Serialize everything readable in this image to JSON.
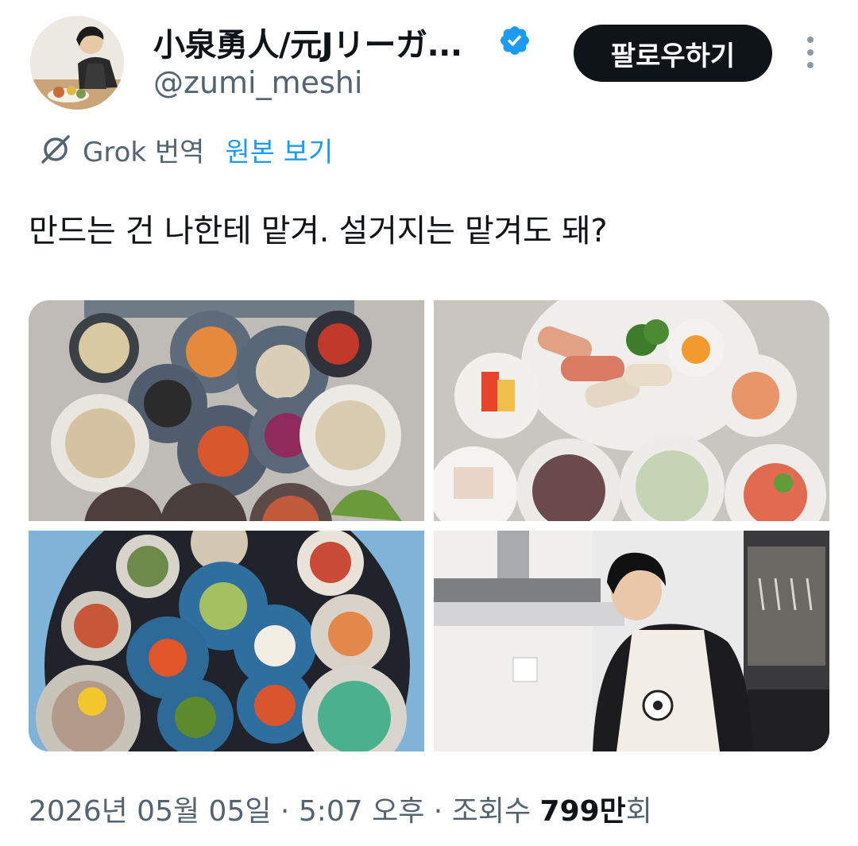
{
  "author": {
    "display_name": "小泉勇人/元Jリーガ...",
    "handle": "@zumi_meshi",
    "verified": true
  },
  "actions": {
    "follow_label": "팔로우하기",
    "more_icon": "more-vertical-icon"
  },
  "translation": {
    "icon": "grok-icon",
    "label": "Grok 번역",
    "link_label": "원본 보기"
  },
  "tweet": {
    "text": "만드는 건 나한테 맡겨. 설거지는 맡겨도 돼?"
  },
  "media": [
    {
      "description": "Gray stone table with small plates of Japanese side dishes (top-down)"
    },
    {
      "description": "Large plate with meat rolls, broccoli, egg yolk and side dishes"
    },
    {
      "description": "Round black tray of colorful side dishes on blue plates"
    },
    {
      "description": "Man in white apron with soccer ball cooking in kitchen"
    }
  ],
  "meta": {
    "date": "2026년 05월 05일",
    "separator": " · ",
    "time": "5:07 오후",
    "views_label": "조회수 ",
    "views_number": "799만",
    "views_suffix": "회"
  },
  "colors": {
    "text_primary": "#0f1419",
    "text_secondary": "#536471",
    "link": "#1d9bf0",
    "follow_bg": "#0f1419",
    "verified": "#1d9bf0"
  }
}
